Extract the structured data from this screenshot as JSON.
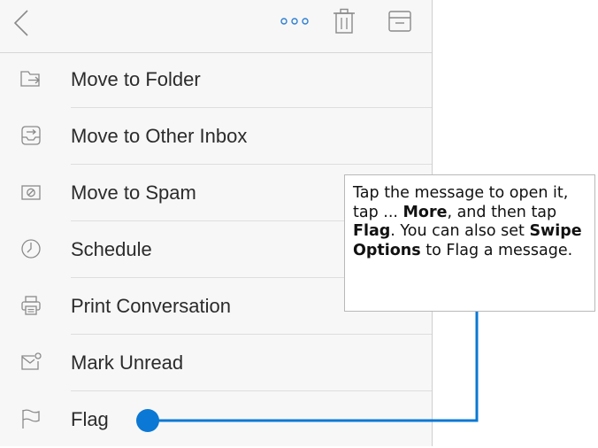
{
  "toolbar": {
    "back_icon": "chevron-left-icon",
    "more_icon": "more-dots-icon",
    "delete_icon": "trash-icon",
    "archive_icon": "archive-icon"
  },
  "menu": {
    "items": [
      {
        "label": "Move to Folder",
        "icon": "folder-move-icon"
      },
      {
        "label": "Move to Other Inbox",
        "icon": "inbox-swap-icon"
      },
      {
        "label": "Move to Spam",
        "icon": "spam-icon"
      },
      {
        "label": "Schedule",
        "icon": "clock-icon"
      },
      {
        "label": "Print Conversation",
        "icon": "printer-icon"
      },
      {
        "label": "Mark Unread",
        "icon": "unread-mail-icon"
      },
      {
        "label": "Flag",
        "icon": "flag-icon"
      }
    ]
  },
  "callout": {
    "text_1": "Tap the message to open it, tap ... ",
    "bold_1": "More",
    "text_2": ", and then tap ",
    "bold_2": "Flag",
    "text_3": ". You can also set ",
    "bold_3": "Swipe Options",
    "text_4": " to Flag a message."
  },
  "colors": {
    "accent": "#0a78d4",
    "icon_gray": "#8a8a8a",
    "text": "#2b2b2b",
    "background": "#f7f7f7"
  }
}
